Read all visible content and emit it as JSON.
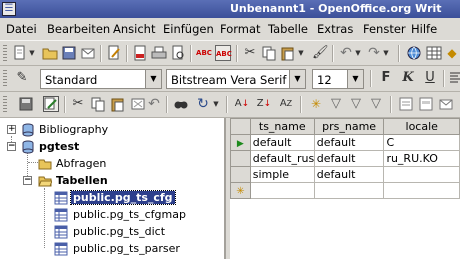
{
  "window": {
    "title": "Unbenannt1 - OpenOffice.org Writ"
  },
  "menubar": [
    {
      "label": "Datei"
    },
    {
      "label": "Bearbeiten"
    },
    {
      "label": "Ansicht"
    },
    {
      "label": "Einfügen"
    },
    {
      "label": "Format"
    },
    {
      "label": "Tabelle"
    },
    {
      "label": "Extras"
    },
    {
      "label": "Fenster"
    },
    {
      "label": "Hilfe"
    }
  ],
  "formatting": {
    "paragraph_style": "Standard",
    "font_name": "Bitstream Vera Serif",
    "font_size": "12",
    "bold_label": "F",
    "italic_label": "K",
    "underline_label": "U"
  },
  "tree": {
    "items": [
      {
        "label": "Bibliography"
      },
      {
        "label": "pgtest"
      },
      {
        "label": "Abfragen"
      },
      {
        "label": "Tabellen"
      },
      {
        "label": "public.pg_ts_cfg"
      },
      {
        "label": "public.pg_ts_cfgmap"
      },
      {
        "label": "public.pg_ts_dict"
      },
      {
        "label": "public.pg_ts_parser"
      }
    ]
  },
  "grid": {
    "columns": [
      "ts_name",
      "prs_name",
      "locale"
    ],
    "rows": [
      [
        "default",
        "default",
        "C"
      ],
      [
        "default_russi",
        "default",
        "ru_RU.KO"
      ],
      [
        "simple",
        "default",
        ""
      ]
    ]
  },
  "colors": {
    "selection": "#2d3f8c",
    "titlebar": "#4a5fa8"
  }
}
